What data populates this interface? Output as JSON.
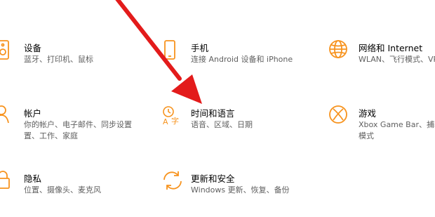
{
  "accent_color": "#f7931e",
  "annotation_arrow_color": "#e31b1b",
  "settings": [
    {
      "id": "devices",
      "icon": "keyboard-speaker-icon",
      "title": "设备",
      "desc_lines": [
        "蓝牙、打印机、鼠标"
      ]
    },
    {
      "id": "phone",
      "icon": "phone-icon",
      "title": "手机",
      "desc_lines": [
        "连接 Android 设备和 iPhone"
      ]
    },
    {
      "id": "network",
      "icon": "globe-icon",
      "title": "网络和 Internet",
      "desc_lines": [
        "WLAN、飞行模式、VP"
      ]
    },
    {
      "id": "accounts",
      "icon": "person-icon",
      "title": "帐户",
      "desc_lines": [
        "你的帐户、电子邮件、同步设置",
        "置、工作、家庭"
      ]
    },
    {
      "id": "time-language",
      "icon": "time-language-icon",
      "title": "时间和语言",
      "desc_lines": [
        "语音、区域、日期"
      ]
    },
    {
      "id": "gaming",
      "icon": "xbox-icon",
      "title": "游戏",
      "desc_lines": [
        "Xbox Game Bar、捕获",
        "模式"
      ]
    },
    {
      "id": "privacy",
      "icon": "lock-icon",
      "title": "隐私",
      "desc_lines": [
        "位置、摄像头、麦克风"
      ]
    },
    {
      "id": "update-security",
      "icon": "sync-icon",
      "title": "更新和安全",
      "desc_lines": [
        "Windows 更新、恢复、备份"
      ]
    }
  ]
}
